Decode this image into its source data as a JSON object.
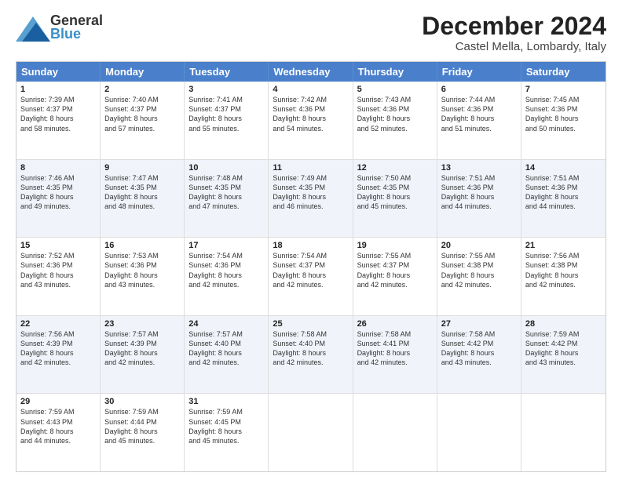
{
  "header": {
    "logo_general": "General",
    "logo_blue": "Blue",
    "month_title": "December 2024",
    "location": "Castel Mella, Lombardy, Italy"
  },
  "weekdays": [
    "Sunday",
    "Monday",
    "Tuesday",
    "Wednesday",
    "Thursday",
    "Friday",
    "Saturday"
  ],
  "weeks": [
    {
      "alt": false,
      "days": [
        {
          "num": "1",
          "sunrise": "7:39 AM",
          "sunset": "4:37 PM",
          "daylight": "8 hours and 58 minutes."
        },
        {
          "num": "2",
          "sunrise": "7:40 AM",
          "sunset": "4:37 PM",
          "daylight": "8 hours and 57 minutes."
        },
        {
          "num": "3",
          "sunrise": "7:41 AM",
          "sunset": "4:37 PM",
          "daylight": "8 hours and 55 minutes."
        },
        {
          "num": "4",
          "sunrise": "7:42 AM",
          "sunset": "4:36 PM",
          "daylight": "8 hours and 54 minutes."
        },
        {
          "num": "5",
          "sunrise": "7:43 AM",
          "sunset": "4:36 PM",
          "daylight": "8 hours and 52 minutes."
        },
        {
          "num": "6",
          "sunrise": "7:44 AM",
          "sunset": "4:36 PM",
          "daylight": "8 hours and 51 minutes."
        },
        {
          "num": "7",
          "sunrise": "7:45 AM",
          "sunset": "4:36 PM",
          "daylight": "8 hours and 50 minutes."
        }
      ]
    },
    {
      "alt": true,
      "days": [
        {
          "num": "8",
          "sunrise": "7:46 AM",
          "sunset": "4:35 PM",
          "daylight": "8 hours and 49 minutes."
        },
        {
          "num": "9",
          "sunrise": "7:47 AM",
          "sunset": "4:35 PM",
          "daylight": "8 hours and 48 minutes."
        },
        {
          "num": "10",
          "sunrise": "7:48 AM",
          "sunset": "4:35 PM",
          "daylight": "8 hours and 47 minutes."
        },
        {
          "num": "11",
          "sunrise": "7:49 AM",
          "sunset": "4:35 PM",
          "daylight": "8 hours and 46 minutes."
        },
        {
          "num": "12",
          "sunrise": "7:50 AM",
          "sunset": "4:35 PM",
          "daylight": "8 hours and 45 minutes."
        },
        {
          "num": "13",
          "sunrise": "7:51 AM",
          "sunset": "4:36 PM",
          "daylight": "8 hours and 44 minutes."
        },
        {
          "num": "14",
          "sunrise": "7:51 AM",
          "sunset": "4:36 PM",
          "daylight": "8 hours and 44 minutes."
        }
      ]
    },
    {
      "alt": false,
      "days": [
        {
          "num": "15",
          "sunrise": "7:52 AM",
          "sunset": "4:36 PM",
          "daylight": "8 hours and 43 minutes."
        },
        {
          "num": "16",
          "sunrise": "7:53 AM",
          "sunset": "4:36 PM",
          "daylight": "8 hours and 43 minutes."
        },
        {
          "num": "17",
          "sunrise": "7:54 AM",
          "sunset": "4:36 PM",
          "daylight": "8 hours and 42 minutes."
        },
        {
          "num": "18",
          "sunrise": "7:54 AM",
          "sunset": "4:37 PM",
          "daylight": "8 hours and 42 minutes."
        },
        {
          "num": "19",
          "sunrise": "7:55 AM",
          "sunset": "4:37 PM",
          "daylight": "8 hours and 42 minutes."
        },
        {
          "num": "20",
          "sunrise": "7:55 AM",
          "sunset": "4:38 PM",
          "daylight": "8 hours and 42 minutes."
        },
        {
          "num": "21",
          "sunrise": "7:56 AM",
          "sunset": "4:38 PM",
          "daylight": "8 hours and 42 minutes."
        }
      ]
    },
    {
      "alt": true,
      "days": [
        {
          "num": "22",
          "sunrise": "7:56 AM",
          "sunset": "4:39 PM",
          "daylight": "8 hours and 42 minutes."
        },
        {
          "num": "23",
          "sunrise": "7:57 AM",
          "sunset": "4:39 PM",
          "daylight": "8 hours and 42 minutes."
        },
        {
          "num": "24",
          "sunrise": "7:57 AM",
          "sunset": "4:40 PM",
          "daylight": "8 hours and 42 minutes."
        },
        {
          "num": "25",
          "sunrise": "7:58 AM",
          "sunset": "4:40 PM",
          "daylight": "8 hours and 42 minutes."
        },
        {
          "num": "26",
          "sunrise": "7:58 AM",
          "sunset": "4:41 PM",
          "daylight": "8 hours and 42 minutes."
        },
        {
          "num": "27",
          "sunrise": "7:58 AM",
          "sunset": "4:42 PM",
          "daylight": "8 hours and 43 minutes."
        },
        {
          "num": "28",
          "sunrise": "7:59 AM",
          "sunset": "4:42 PM",
          "daylight": "8 hours and 43 minutes."
        }
      ]
    },
    {
      "alt": false,
      "days": [
        {
          "num": "29",
          "sunrise": "7:59 AM",
          "sunset": "4:43 PM",
          "daylight": "8 hours and 44 minutes."
        },
        {
          "num": "30",
          "sunrise": "7:59 AM",
          "sunset": "4:44 PM",
          "daylight": "8 hours and 45 minutes."
        },
        {
          "num": "31",
          "sunrise": "7:59 AM",
          "sunset": "4:45 PM",
          "daylight": "8 hours and 45 minutes."
        },
        null,
        null,
        null,
        null
      ]
    }
  ],
  "labels": {
    "sunrise": "Sunrise:",
    "sunset": "Sunset:",
    "daylight": "Daylight:"
  }
}
